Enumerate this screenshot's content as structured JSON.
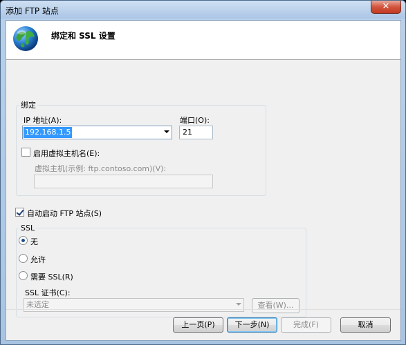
{
  "window": {
    "title": "添加 FTP 站点",
    "close_glyph": "✕"
  },
  "header": {
    "title": "绑定和 SSL 设置",
    "icon": "globe-icon"
  },
  "binding": {
    "legend": "绑定",
    "ip_label": "IP 地址(A):",
    "ip_value": "192.168.1.5",
    "port_label": "端口(O):",
    "port_value": "21",
    "virtual_host_checkbox_label": "启用虚拟主机名(E):",
    "virtual_host_checked": false,
    "virtual_host_label": "虚拟主机(示例: ftp.contoso.com)(V):",
    "virtual_host_value": ""
  },
  "auto_start": {
    "label": "自动启动 FTP 站点(S)",
    "checked": true
  },
  "ssl": {
    "legend": "SSL",
    "options": [
      {
        "label": "无",
        "selected": true
      },
      {
        "label": "允许",
        "selected": false
      },
      {
        "label": "需要 SSL(R)",
        "selected": false
      }
    ],
    "cert_label": "SSL 证书(C):",
    "cert_value": "未选定",
    "view_button": "查看(W)..."
  },
  "buttons": {
    "previous": "上一页(P)",
    "next": "下一步(N)",
    "finish": "完成(F)",
    "cancel": "取消"
  }
}
